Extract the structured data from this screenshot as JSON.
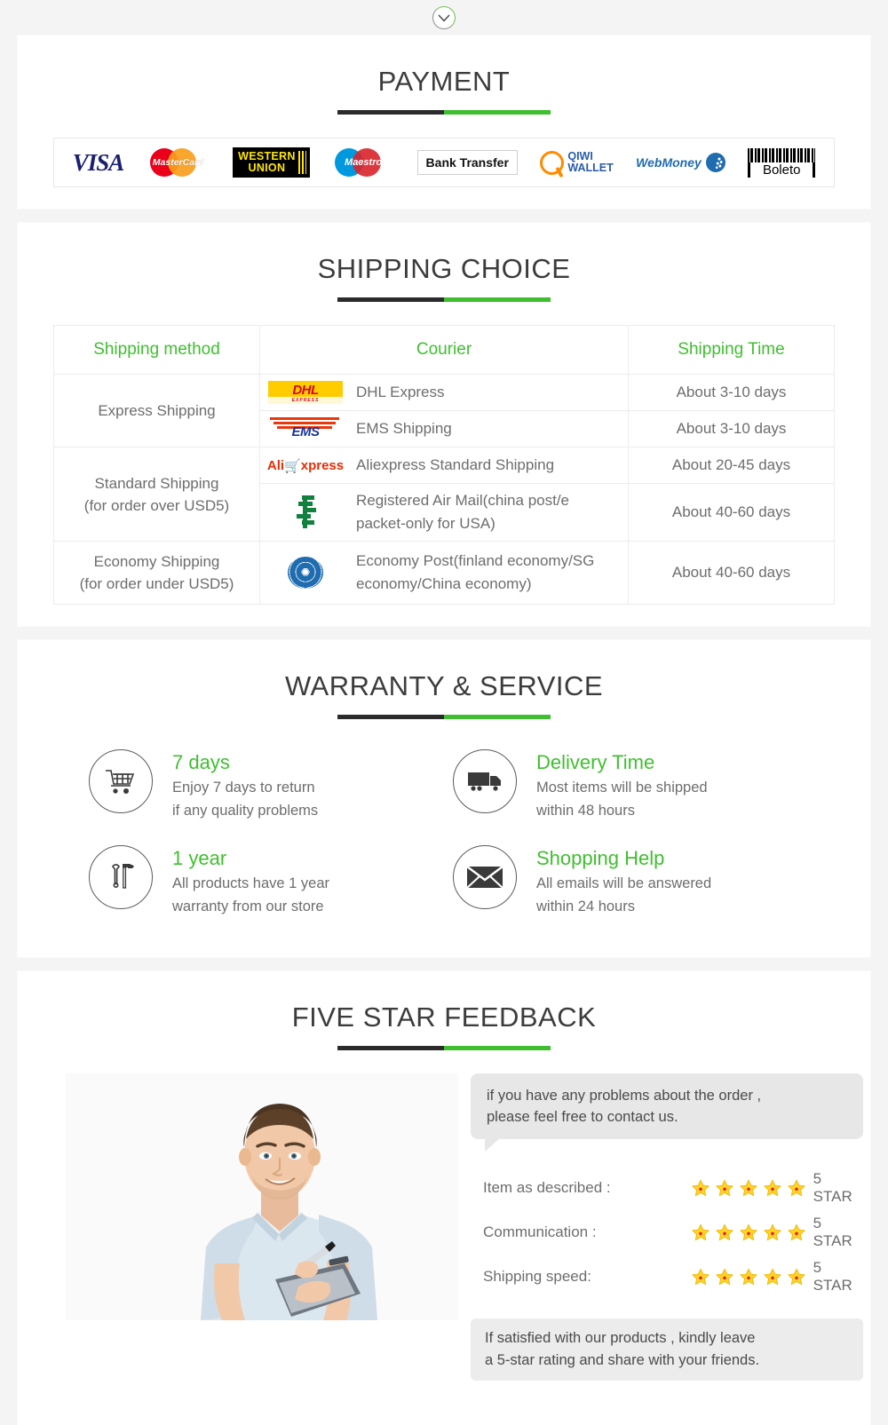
{
  "top": {
    "icon": "chevron-down-circle-icon"
  },
  "payment": {
    "title": "PAYMENT",
    "methods": [
      {
        "name": "visa",
        "label": "VISA"
      },
      {
        "name": "mastercard",
        "label": "MasterCard"
      },
      {
        "name": "western-union",
        "label_1": "WESTERN",
        "label_2": "UNION"
      },
      {
        "name": "maestro",
        "label": "Maestro"
      },
      {
        "name": "bank-transfer",
        "label": "Bank Transfer"
      },
      {
        "name": "qiwi-wallet",
        "label_1": "QIWI",
        "label_2": "WALLET"
      },
      {
        "name": "webmoney",
        "label": "WebMoney"
      },
      {
        "name": "boleto",
        "label": "Boleto"
      }
    ]
  },
  "shipping": {
    "title": "SHIPPING CHOICE",
    "columns": [
      "Shipping method",
      "Courier",
      "Shipping Time"
    ],
    "groups": [
      {
        "method": "Express Shipping",
        "rows": [
          {
            "logo": "dhl-logo",
            "courier": "DHL Express",
            "time": "About 3-10 days"
          },
          {
            "logo": "ems-logo",
            "courier": "EMS Shipping",
            "time": "About 3-10 days"
          }
        ]
      },
      {
        "method": "Standard Shipping\n(for order over USD5)",
        "method_line1": "Standard Shipping",
        "method_line2": "(for order over USD5)",
        "rows": [
          {
            "logo": "aliexpress-logo",
            "courier": "Aliexpress Standard Shipping",
            "time": "About 20-45 days"
          },
          {
            "logo": "china-post-logo",
            "courier": "Registered Air Mail(china post/e packet-only for USA)",
            "time": "About 40-60 days"
          }
        ]
      },
      {
        "method_line1": "Economy Shipping",
        "method_line2": "(for order under USD5)",
        "rows": [
          {
            "logo": "un-logo",
            "courier": "Economy Post(finland economy/SG economy/China economy)",
            "time": "About 40-60 days"
          }
        ]
      }
    ]
  },
  "warranty": {
    "title": "WARRANTY & SERVICE",
    "items": [
      {
        "icon": "shopping-cart-icon",
        "heading": "7 days",
        "line1": "Enjoy 7 days to return",
        "line2": "if any quality problems"
      },
      {
        "icon": "delivery-truck-icon",
        "heading": "Delivery Time",
        "line1": "Most items will be shipped",
        "line2": "within 48 hours"
      },
      {
        "icon": "tools-icon",
        "heading": "1 year",
        "line1": "All products have 1 year",
        "line2": "warranty from our store"
      },
      {
        "icon": "envelope-icon",
        "heading": "Shopping Help",
        "line1": "All emails will be answered",
        "line2": "within 24 hours"
      }
    ]
  },
  "feedback": {
    "title": "FIVE STAR FEEDBACK",
    "photo_alt": "smiling-man-with-clipboard-photo",
    "bubble_line1": "if you have any problems about the order ,",
    "bubble_line2": "please feel free to contact us.",
    "ratings": [
      {
        "label": "Item as described :",
        "stars": 5,
        "value": "5 STAR"
      },
      {
        "label": "Communication :",
        "stars": 5,
        "value": "5 STAR"
      },
      {
        "label": "Shipping speed:",
        "stars": 5,
        "value": "5 STAR"
      }
    ],
    "note_line1": "If satisfied with our products , kindly leave",
    "note_line2": "a 5-star rating and share with your friends."
  },
  "colors": {
    "green": "#3fbf2f",
    "dark_rule": "#2b2b2b",
    "heading_gray": "#3c3c3c",
    "body_gray": "#6d6d6d",
    "page_bg": "#f4f4f4",
    "star_gold": "#ffd42a"
  }
}
